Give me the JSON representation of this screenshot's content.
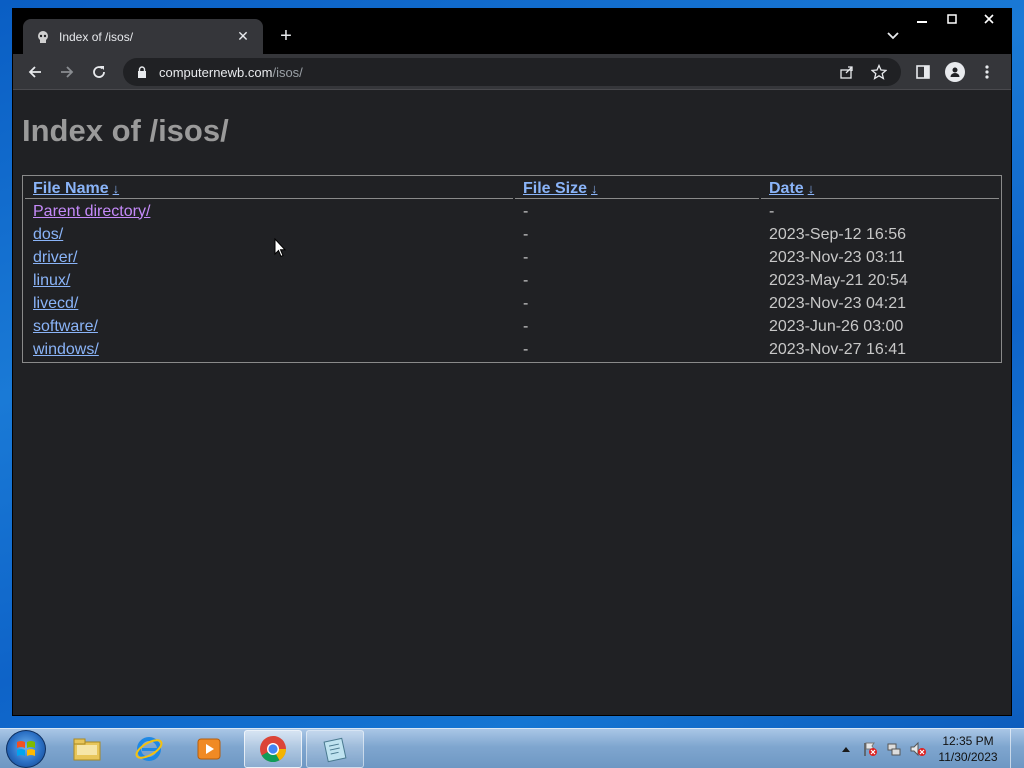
{
  "browser": {
    "tab_title": "Index of /isos/",
    "tab_close": "✕",
    "new_tab": "+",
    "url_host": "computernewb.com",
    "url_path": "/isos/",
    "window_controls": {
      "minimize": "—",
      "maximize": "☐",
      "close": "✕"
    }
  },
  "page": {
    "title": "Index of /isos/",
    "columns": [
      {
        "label": "File Name",
        "arrow": "↓"
      },
      {
        "label": "File Size",
        "arrow": "↓"
      },
      {
        "label": "Date",
        "arrow": "↓"
      }
    ],
    "rows": [
      {
        "name": "Parent directory/",
        "size": "-",
        "date": "-",
        "visited": true
      },
      {
        "name": "dos/",
        "size": "-",
        "date": "2023-Sep-12 16:56",
        "visited": false
      },
      {
        "name": "driver/",
        "size": "-",
        "date": "2023-Nov-23 03:11",
        "visited": false
      },
      {
        "name": "linux/",
        "size": "-",
        "date": "2023-May-21 20:54",
        "visited": false
      },
      {
        "name": "livecd/",
        "size": "-",
        "date": "2023-Nov-23 04:21",
        "visited": false
      },
      {
        "name": "software/",
        "size": "-",
        "date": "2023-Jun-26 03:00",
        "visited": false
      },
      {
        "name": "windows/",
        "size": "-",
        "date": "2023-Nov-27 16:41",
        "visited": false
      }
    ]
  },
  "taskbar": {
    "apps": [
      "windows-explorer-icon",
      "internet-explorer-icon",
      "media-player-icon",
      "chrome-icon",
      "notepad-icon"
    ],
    "time": "12:35 PM",
    "date": "11/30/2023"
  },
  "colors": {
    "link": "#8ab4f8",
    "visited_link": "#c58af9",
    "page_bg": "#202124",
    "title_gray": "#9a9a9a"
  }
}
